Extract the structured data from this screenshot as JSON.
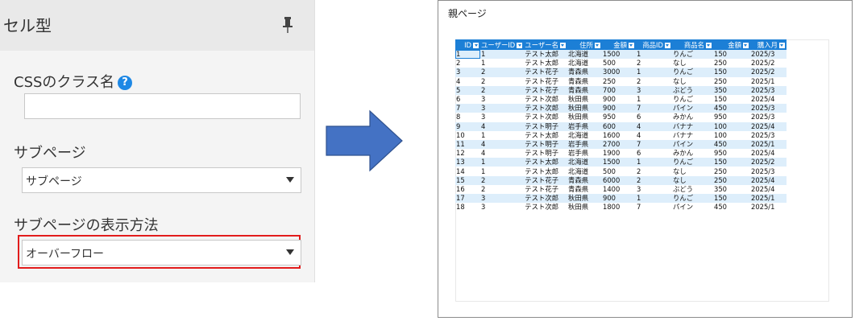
{
  "panel": {
    "title": "セル型",
    "css_label": "CSSのクラス名",
    "css_value": "",
    "subpage_label": "サブページ",
    "subpage_value": "サブページ",
    "display_label": "サブページの表示方法",
    "display_value": "オーバーフロー",
    "highlight_color": "#e21c1c",
    "help_icon": "question-circle-icon",
    "pin_icon": "pin-icon"
  },
  "arrow": {
    "color": "#4472c4",
    "icon": "right-arrow-icon"
  },
  "preview": {
    "page_title": "親ページ",
    "header_color": "#1c7fd6",
    "alt_row_color": "#ddeefb",
    "columns": [
      "ID",
      "ユーザーID",
      "ユーザー名",
      "住所",
      "金額",
      "商品ID",
      "商品名",
      "金額",
      "購入月"
    ],
    "rows": [
      [
        "1",
        "1",
        "テスト太郎",
        "北海道",
        "1500",
        "1",
        "りんご",
        "150",
        "2025/3"
      ],
      [
        "2",
        "1",
        "テスト太郎",
        "北海道",
        "500",
        "2",
        "なし",
        "250",
        "2025/2"
      ],
      [
        "3",
        "2",
        "テスト花子",
        "青森県",
        "3000",
        "1",
        "りんご",
        "150",
        "2025/2"
      ],
      [
        "4",
        "2",
        "テスト花子",
        "青森県",
        "250",
        "2",
        "なし",
        "250",
        "2025/1"
      ],
      [
        "5",
        "2",
        "テスト花子",
        "青森県",
        "700",
        "3",
        "ぶどう",
        "350",
        "2025/3"
      ],
      [
        "6",
        "3",
        "テスト次郎",
        "秋田県",
        "900",
        "1",
        "りんご",
        "150",
        "2025/4"
      ],
      [
        "7",
        "3",
        "テスト次郎",
        "秋田県",
        "900",
        "7",
        "パイン",
        "450",
        "2025/3"
      ],
      [
        "8",
        "3",
        "テスト次郎",
        "秋田県",
        "950",
        "6",
        "みかん",
        "950",
        "2025/3"
      ],
      [
        "9",
        "4",
        "テスト明子",
        "岩手県",
        "600",
        "4",
        "バナナ",
        "100",
        "2025/4"
      ],
      [
        "10",
        "1",
        "テスト太郎",
        "北海道",
        "1600",
        "4",
        "バナナ",
        "100",
        "2025/3"
      ],
      [
        "11",
        "4",
        "テスト明子",
        "岩手県",
        "2700",
        "7",
        "パイン",
        "450",
        "2025/1"
      ],
      [
        "12",
        "4",
        "テスト明子",
        "岩手県",
        "1900",
        "6",
        "みかん",
        "950",
        "2025/4"
      ],
      [
        "13",
        "1",
        "テスト太郎",
        "北海道",
        "1500",
        "1",
        "りんご",
        "150",
        "2025/2"
      ],
      [
        "14",
        "1",
        "テスト太郎",
        "北海道",
        "500",
        "2",
        "なし",
        "250",
        "2025/3"
      ],
      [
        "15",
        "2",
        "テスト花子",
        "青森県",
        "6000",
        "2",
        "なし",
        "250",
        "2025/4"
      ],
      [
        "16",
        "2",
        "テスト花子",
        "青森県",
        "1400",
        "3",
        "ぶどう",
        "350",
        "2025/4"
      ],
      [
        "17",
        "3",
        "テスト次郎",
        "秋田県",
        "900",
        "1",
        "りんご",
        "150",
        "2025/1"
      ],
      [
        "18",
        "3",
        "テスト次郎",
        "秋田県",
        "1800",
        "7",
        "パイン",
        "450",
        "2025/1"
      ]
    ]
  }
}
